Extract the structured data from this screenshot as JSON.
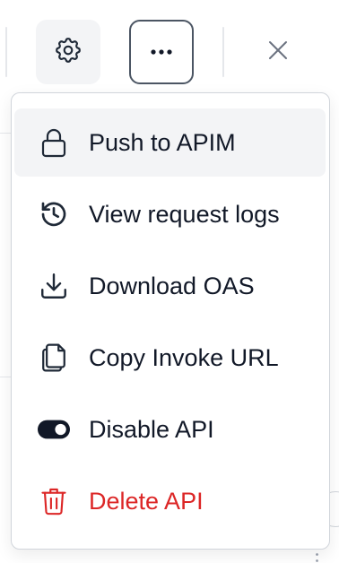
{
  "toolbar": {
    "buttons": [
      {
        "name": "settings",
        "icon": "gear-icon"
      },
      {
        "name": "more-options",
        "icon": "ellipsis-icon",
        "active": true
      },
      {
        "name": "close",
        "icon": "close-icon"
      }
    ]
  },
  "menu": {
    "items": [
      {
        "label": "Push to APIM",
        "icon": "lock-icon",
        "highlighted": true
      },
      {
        "label": "View request logs",
        "icon": "history-icon"
      },
      {
        "label": "Download OAS",
        "icon": "download-icon"
      },
      {
        "label": "Copy Invoke URL",
        "icon": "copy-icon"
      },
      {
        "label": "Disable API",
        "icon": "toggle-on-icon"
      },
      {
        "label": "Delete API",
        "icon": "trash-icon",
        "danger": true
      }
    ]
  },
  "colors": {
    "text": "#111827",
    "danger": "#dc2626",
    "highlight_bg": "#f3f4f6",
    "border": "#d1d5db",
    "icon": "#1f2937"
  }
}
